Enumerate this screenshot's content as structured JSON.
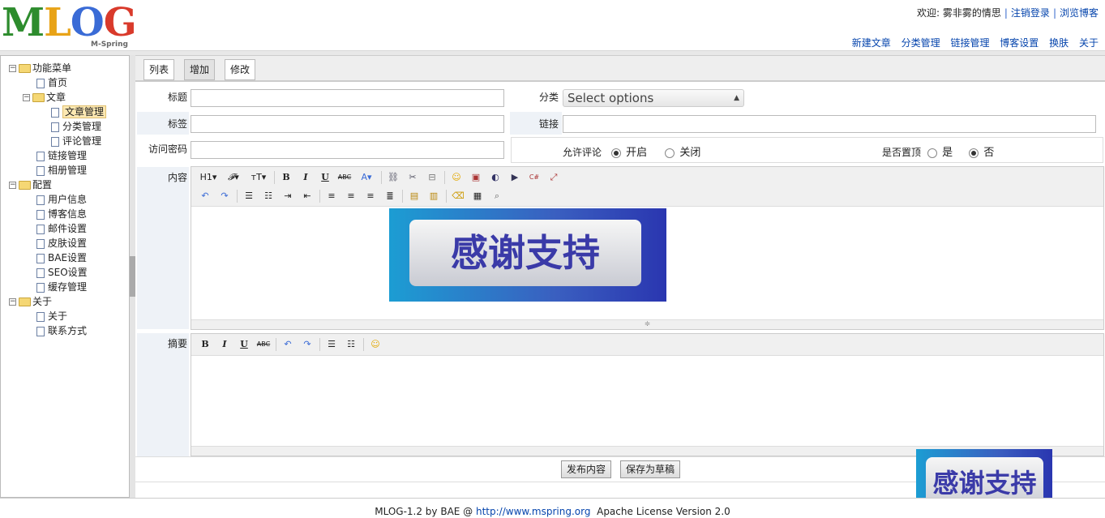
{
  "header": {
    "logo_text": "MLOG",
    "logo_sub": "M-Spring",
    "welcome": "欢迎: 雾非雾的情思",
    "logout": "注销登录",
    "browse": "浏览博客",
    "nav": [
      "新建文章",
      "分类管理",
      "链接管理",
      "博客设置",
      "换肤",
      "关于"
    ]
  },
  "sidebar": {
    "root1": "功能菜单",
    "home": "首页",
    "articles": "文章",
    "article_mgmt": "文章管理",
    "category_mgmt": "分类管理",
    "comment_mgmt": "评论管理",
    "link_mgmt": "链接管理",
    "album_mgmt": "相册管理",
    "config": "配置",
    "user_info": "用户信息",
    "blog_info": "博客信息",
    "mail": "邮件设置",
    "skin": "皮肤设置",
    "bae": "BAE设置",
    "seo": "SEO设置",
    "cache": "缓存管理",
    "about_root": "关于",
    "about": "关于",
    "contact": "联系方式"
  },
  "tabs": [
    "列表",
    "增加",
    "修改"
  ],
  "form": {
    "title_label": "标题",
    "category_label": "分类",
    "category_placeholder": "Select options",
    "tags_label": "标签",
    "link_label": "链接",
    "password_label": "访问密码",
    "allow_comment_label": "允许评论",
    "comment_on": "开启",
    "comment_off": "关闭",
    "pin_label": "是否置顶",
    "pin_yes": "是",
    "pin_no": "否",
    "content_label": "内容",
    "summary_label": "摘要",
    "banner_text": "感谢支持",
    "publish": "发布内容",
    "save_draft": "保存为草稿"
  },
  "footer": {
    "prefix": "MLOG-1.2 by BAE @ ",
    "url": "http://www.mspring.org",
    "license": "Apache License Version 2.0"
  },
  "colors": {
    "link": "#0645ad",
    "label_cell": "#eef2f7",
    "banner": "#3a5fc0"
  }
}
